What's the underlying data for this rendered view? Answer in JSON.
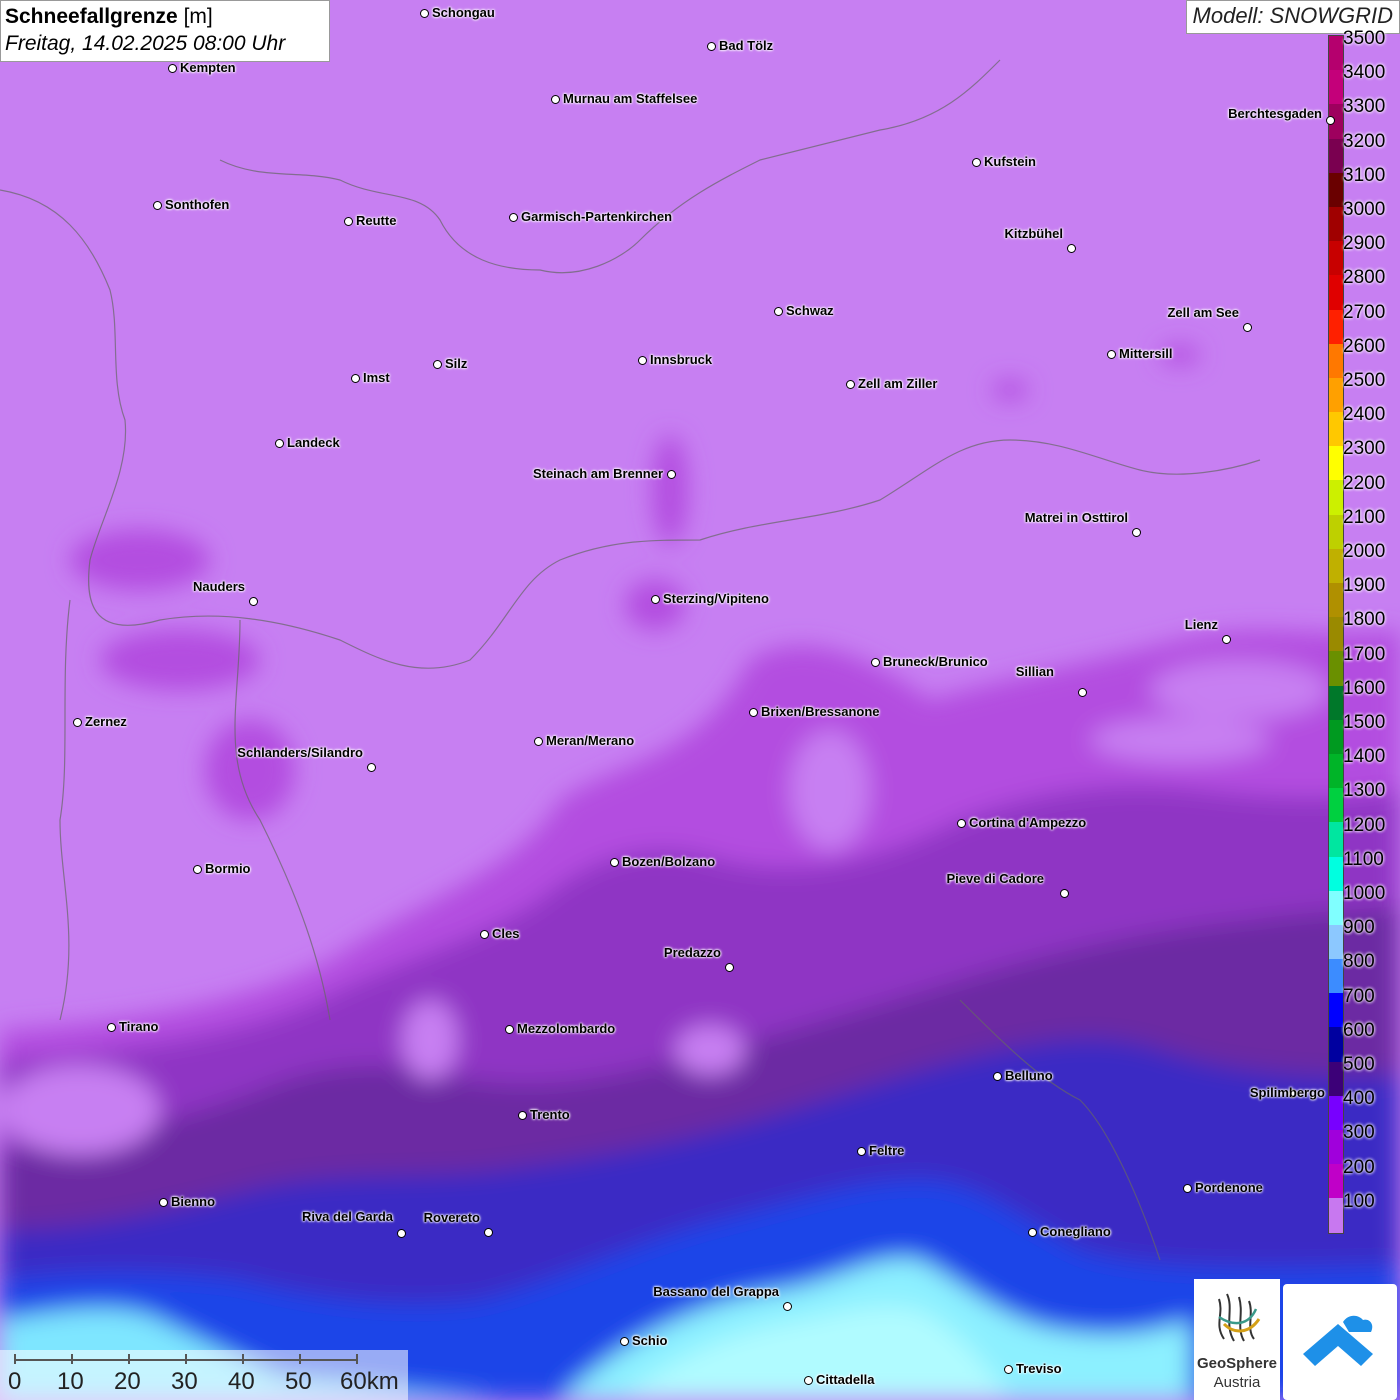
{
  "header": {
    "title_bold": "Schneefallgrenze",
    "title_unit": "[m]",
    "date": "Freitag, 14.02.2025 08:00 Uhr",
    "model": "Modell: SNOWGRID"
  },
  "legend": {
    "labels": [
      "3500",
      "3400",
      "3300",
      "3200",
      "3100",
      "3000",
      "2900",
      "2800",
      "2700",
      "2600",
      "2500",
      "2400",
      "2300",
      "2200",
      "2100",
      "2000",
      "1900",
      "1800",
      "1700",
      "1600",
      "1500",
      "1400",
      "1300",
      "1200",
      "1100",
      "1000",
      "900",
      "800",
      "700",
      "600",
      "500",
      "400",
      "300",
      "200",
      "100"
    ],
    "colors": [
      "#b5006e",
      "#c4007a",
      "#9e005e",
      "#7a0050",
      "#6a0000",
      "#a00000",
      "#c80000",
      "#e00000",
      "#ff2000",
      "#ff7800",
      "#ffa000",
      "#ffc800",
      "#ffff00",
      "#ccf000",
      "#bed000",
      "#c0b000",
      "#b09000",
      "#9a8a00",
      "#6a9000",
      "#00782a",
      "#009a20",
      "#00b428",
      "#00d040",
      "#00e6a0",
      "#00ffe0",
      "#80ffff",
      "#8cc8ff",
      "#3c8cff",
      "#0000ff",
      "#0000a0",
      "#3c0078",
      "#7800ff",
      "#a000dc",
      "#c000c8",
      "#c878f0"
    ]
  },
  "cities": [
    {
      "name": "Schongau"
    },
    {
      "name": "Bad Tölz"
    },
    {
      "name": "Kempten"
    },
    {
      "name": "Murnau am Staffelsee"
    },
    {
      "name": "Berchtesgaden"
    },
    {
      "name": "Kufstein"
    },
    {
      "name": "Sonthofen"
    },
    {
      "name": "Reutte"
    },
    {
      "name": "Garmisch-Partenkirchen"
    },
    {
      "name": "Kitzbühel"
    },
    {
      "name": "Schwaz"
    },
    {
      "name": "Zell am See"
    },
    {
      "name": "Innsbruck"
    },
    {
      "name": "Mittersill"
    },
    {
      "name": "Imst"
    },
    {
      "name": "Silz"
    },
    {
      "name": "Zell am Ziller"
    },
    {
      "name": "Landeck"
    },
    {
      "name": "Steinach am Brenner"
    },
    {
      "name": "Matrei in Osttirol"
    },
    {
      "name": "Nauders"
    },
    {
      "name": "Sterzing/Vipiteno"
    },
    {
      "name": "Lienz"
    },
    {
      "name": "Bruneck/Brunico"
    },
    {
      "name": "Sillian"
    },
    {
      "name": "Zernez"
    },
    {
      "name": "Brixen/Bressanone"
    },
    {
      "name": "Meran/Merano"
    },
    {
      "name": "Schlanders/Silandro"
    },
    {
      "name": "Cortina d'Ampezzo"
    },
    {
      "name": "Bozen/Bolzano"
    },
    {
      "name": "Bormio"
    },
    {
      "name": "Pieve di Cadore"
    },
    {
      "name": "Cles"
    },
    {
      "name": "Predazzo"
    },
    {
      "name": "Tirano"
    },
    {
      "name": "Mezzolombardo"
    },
    {
      "name": "Belluno"
    },
    {
      "name": "Spilimbergo"
    },
    {
      "name": "Trento"
    },
    {
      "name": "Feltre"
    },
    {
      "name": "Pordenone"
    },
    {
      "name": "Bienno"
    },
    {
      "name": "Riva del Garda"
    },
    {
      "name": "Rovereto"
    },
    {
      "name": "Conegliano"
    },
    {
      "name": "Bassano del Grappa"
    },
    {
      "name": "Schio"
    },
    {
      "name": "Treviso"
    },
    {
      "name": "Cittadella"
    }
  ],
  "scalebar": {
    "labels": [
      "0",
      "10",
      "20",
      "30",
      "40",
      "50",
      "60km"
    ]
  },
  "logos": {
    "geosphere_line1": "GeoSphere",
    "geosphere_line2": "Austria"
  }
}
